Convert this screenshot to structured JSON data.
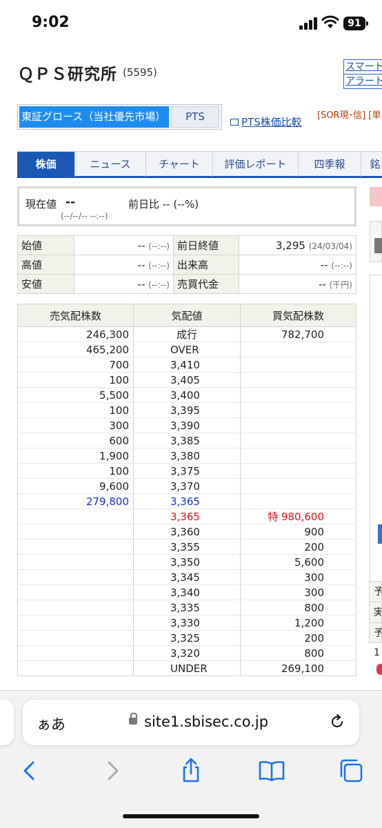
{
  "status_bar": {
    "time": "9:02",
    "battery": "91"
  },
  "header": {
    "title": "ＱＰＳ研究所",
    "code": "(5595)",
    "side_links": [
      "スマート",
      "アラート"
    ]
  },
  "market_tabs": {
    "active": "東証グロース（当社優先市場）",
    "pts": "PTS",
    "pts_compare": "PTS株価比較",
    "sor": "[SOR現･信] [単"
  },
  "nav_tabs": [
    "株価",
    "ニュース",
    "チャート",
    "評価レポート",
    "四季報",
    "銘"
  ],
  "current": {
    "label": "現在値",
    "value": "--",
    "time": "(--/--/-- --:--)",
    "diff": "前日比 -- (--%)"
  },
  "summary": [
    {
      "label": "始値",
      "value": "--",
      "value_sub": "(--:--)",
      "label2": "前日終値",
      "value2": "3,295",
      "value2_sub": "(24/03/04)"
    },
    {
      "label": "高値",
      "value": "--",
      "value_sub": "(--:--)",
      "label2": "出来高",
      "value2": "--",
      "value2_sub": "(--:--)"
    },
    {
      "label": "安値",
      "value": "--",
      "value_sub": "(--:--)",
      "label2": "売買代金",
      "value2": "--",
      "value2_sub": "(千円)"
    }
  ],
  "order_book": {
    "headers": [
      "売気配株数",
      "気配値",
      "買気配株数"
    ],
    "rows": [
      {
        "sell": "246,300",
        "price": "成行",
        "buy": "782,700",
        "center": true
      },
      {
        "sell": "465,200",
        "price": "OVER",
        "buy": ""
      },
      {
        "sell": "700",
        "price": "3,410",
        "buy": ""
      },
      {
        "sell": "100",
        "price": "3,405",
        "buy": ""
      },
      {
        "sell": "5,500",
        "price": "3,400",
        "buy": ""
      },
      {
        "sell": "100",
        "price": "3,395",
        "buy": ""
      },
      {
        "sell": "300",
        "price": "3,390",
        "buy": ""
      },
      {
        "sell": "600",
        "price": "3,385",
        "buy": ""
      },
      {
        "sell": "1,900",
        "price": "3,380",
        "buy": ""
      },
      {
        "sell": "100",
        "price": "3,375",
        "buy": ""
      },
      {
        "sell": "9,600",
        "price": "3,370",
        "buy": ""
      },
      {
        "sell": "279,800",
        "price": "3,365",
        "buy": "",
        "color": "blue"
      },
      {
        "sell": "",
        "price": "3,365",
        "buy": "特 980,600",
        "color": "red"
      },
      {
        "sell": "",
        "price": "3,360",
        "buy": "900"
      },
      {
        "sell": "",
        "price": "3,355",
        "buy": "200"
      },
      {
        "sell": "",
        "price": "3,350",
        "buy": "5,600"
      },
      {
        "sell": "",
        "price": "3,345",
        "buy": "300"
      },
      {
        "sell": "",
        "price": "3,340",
        "buy": "300"
      },
      {
        "sell": "",
        "price": "3,335",
        "buy": "800"
      },
      {
        "sell": "",
        "price": "3,330",
        "buy": "1,200"
      },
      {
        "sell": "",
        "price": "3,325",
        "buy": "200"
      },
      {
        "sell": "",
        "price": "3,320",
        "buy": "800"
      },
      {
        "sell": "",
        "price": "UNDER",
        "buy": "269,100"
      }
    ]
  },
  "edge": {
    "rows": [
      "予",
      "実",
      "予"
    ],
    "small": "1"
  },
  "browser": {
    "aa": "ぁあ",
    "url": "site1.sbisec.co.jp"
  },
  "colors": {
    "accent": "#1b58b6",
    "market_active": "#1d8cf0",
    "blue_quote": "#1a32c8",
    "red_quote": "#e0101c"
  }
}
